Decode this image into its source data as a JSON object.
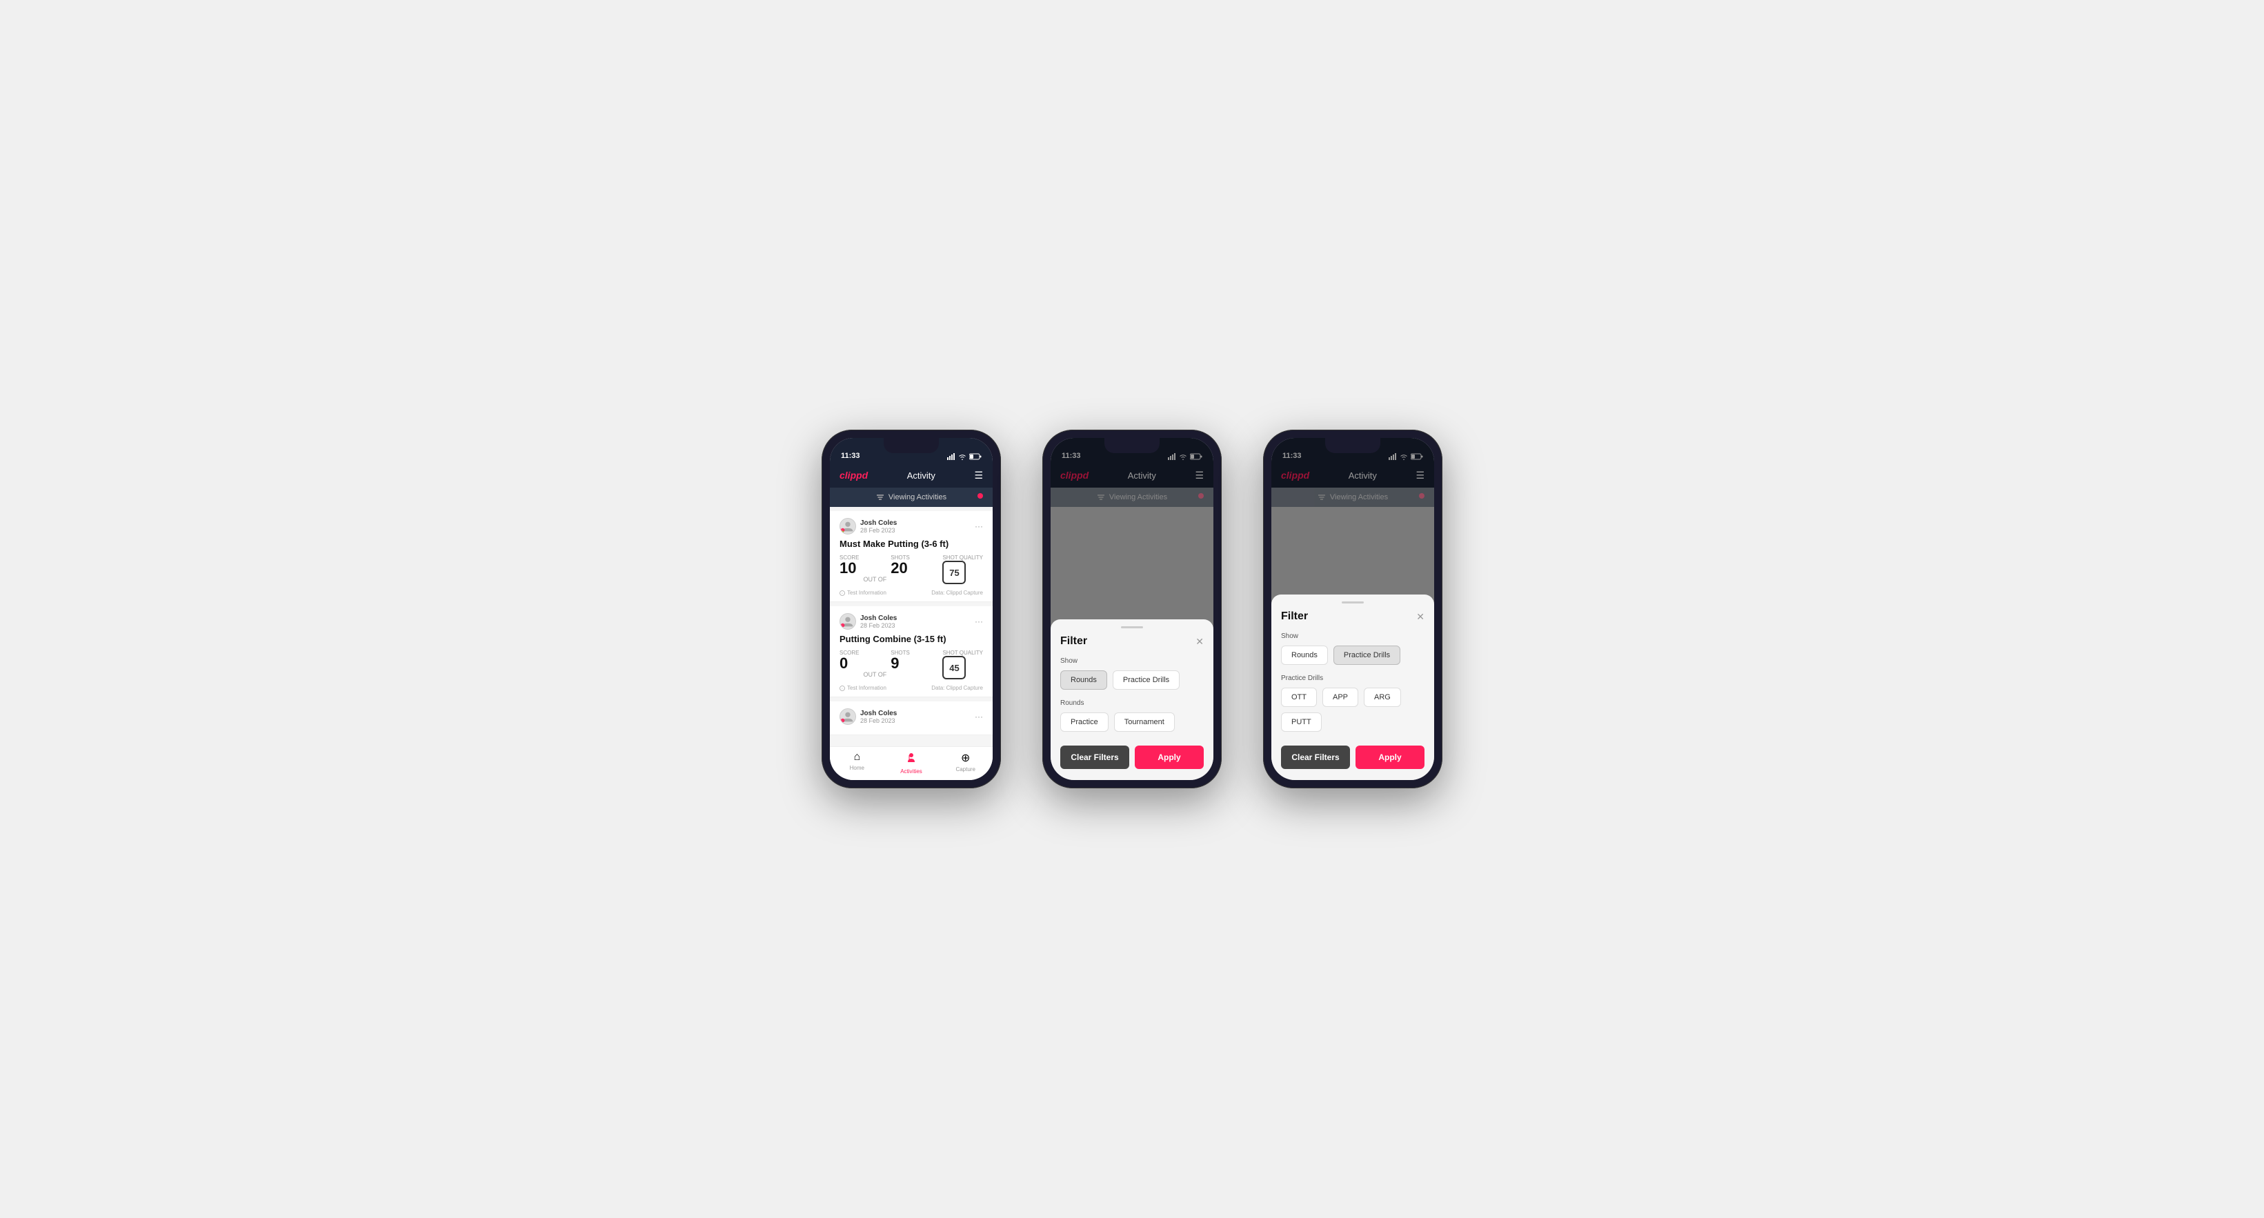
{
  "phones": [
    {
      "id": "phone1",
      "statusBar": {
        "time": "11:33",
        "batteryLevel": "31"
      },
      "nav": {
        "logo": "clippd",
        "title": "Activity"
      },
      "viewingBar": {
        "text": "Viewing Activities"
      },
      "cards": [
        {
          "userName": "Josh Coles",
          "userDate": "28 Feb 2023",
          "title": "Must Make Putting (3-6 ft)",
          "scoreLabel": "Score",
          "scoreValue": "10",
          "outOfLabel": "OUT OF",
          "shotsLabel": "Shots",
          "shotsValue": "20",
          "shotQualityLabel": "Shot Quality",
          "shotQualityValue": "75",
          "infoText": "Test Information",
          "dataText": "Data: Clippd Capture"
        },
        {
          "userName": "Josh Coles",
          "userDate": "28 Feb 2023",
          "title": "Putting Combine (3-15 ft)",
          "scoreLabel": "Score",
          "scoreValue": "0",
          "outOfLabel": "OUT OF",
          "shotsLabel": "Shots",
          "shotsValue": "9",
          "shotQualityLabel": "Shot Quality",
          "shotQualityValue": "45",
          "infoText": "Test Information",
          "dataText": "Data: Clippd Capture"
        },
        {
          "userName": "Josh Coles",
          "userDate": "28 Feb 2023",
          "title": "",
          "scoreLabel": "",
          "scoreValue": "",
          "outOfLabel": "",
          "shotsLabel": "",
          "shotsValue": "",
          "shotQualityLabel": "",
          "shotQualityValue": "",
          "infoText": "",
          "dataText": ""
        }
      ],
      "tabBar": {
        "home": "Home",
        "activities": "Activities",
        "capture": "Capture"
      }
    },
    {
      "id": "phone2",
      "statusBar": {
        "time": "11:33",
        "batteryLevel": "31"
      },
      "nav": {
        "logo": "clippd",
        "title": "Activity"
      },
      "viewingBar": {
        "text": "Viewing Activities"
      },
      "filter": {
        "title": "Filter",
        "showLabel": "Show",
        "showButtons": [
          {
            "label": "Rounds",
            "active": true
          },
          {
            "label": "Practice Drills",
            "active": false
          }
        ],
        "roundsLabel": "Rounds",
        "roundsButtons": [
          {
            "label": "Practice",
            "active": false
          },
          {
            "label": "Tournament",
            "active": false
          }
        ],
        "clearLabel": "Clear Filters",
        "applyLabel": "Apply"
      }
    },
    {
      "id": "phone3",
      "statusBar": {
        "time": "11:33",
        "batteryLevel": "31"
      },
      "nav": {
        "logo": "clippd",
        "title": "Activity"
      },
      "viewingBar": {
        "text": "Viewing Activities"
      },
      "filter": {
        "title": "Filter",
        "showLabel": "Show",
        "showButtons": [
          {
            "label": "Rounds",
            "active": false
          },
          {
            "label": "Practice Drills",
            "active": true
          }
        ],
        "practiceDrillsLabel": "Practice Drills",
        "drillButtons": [
          {
            "label": "OTT",
            "active": false
          },
          {
            "label": "APP",
            "active": false
          },
          {
            "label": "ARG",
            "active": false
          },
          {
            "label": "PUTT",
            "active": false
          }
        ],
        "clearLabel": "Clear Filters",
        "applyLabel": "Apply"
      }
    }
  ]
}
